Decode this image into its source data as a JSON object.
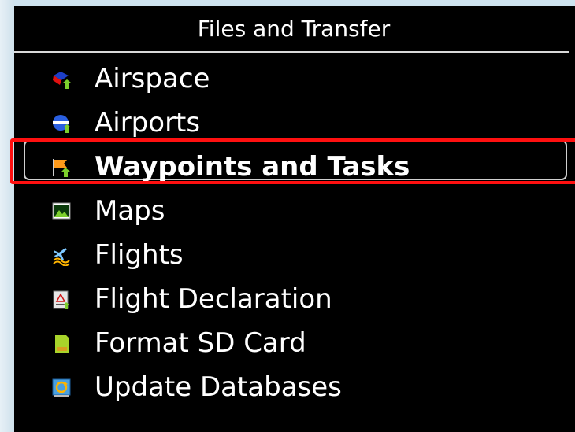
{
  "window": {
    "title": "Files and Transfer"
  },
  "menu": {
    "items": [
      {
        "label": "Airspace",
        "icon": "airspace-icon",
        "selected": false
      },
      {
        "label": "Airports",
        "icon": "airports-icon",
        "selected": false
      },
      {
        "label": "Waypoints and Tasks",
        "icon": "waypoints-flag-icon",
        "selected": true
      },
      {
        "label": "Maps",
        "icon": "maps-icon",
        "selected": false
      },
      {
        "label": "Flights",
        "icon": "flights-icon",
        "selected": false
      },
      {
        "label": "Flight Declaration",
        "icon": "flight-declaration-icon",
        "selected": false
      },
      {
        "label": "Format SD Card",
        "icon": "sd-card-icon",
        "selected": false
      },
      {
        "label": "Update Databases",
        "icon": "update-databases-icon",
        "selected": false
      }
    ]
  },
  "colors": {
    "panel_bg": "#000000",
    "text": "#ffffff",
    "highlight_border": "#ff1010",
    "selection_border": "#d0d0d0"
  }
}
